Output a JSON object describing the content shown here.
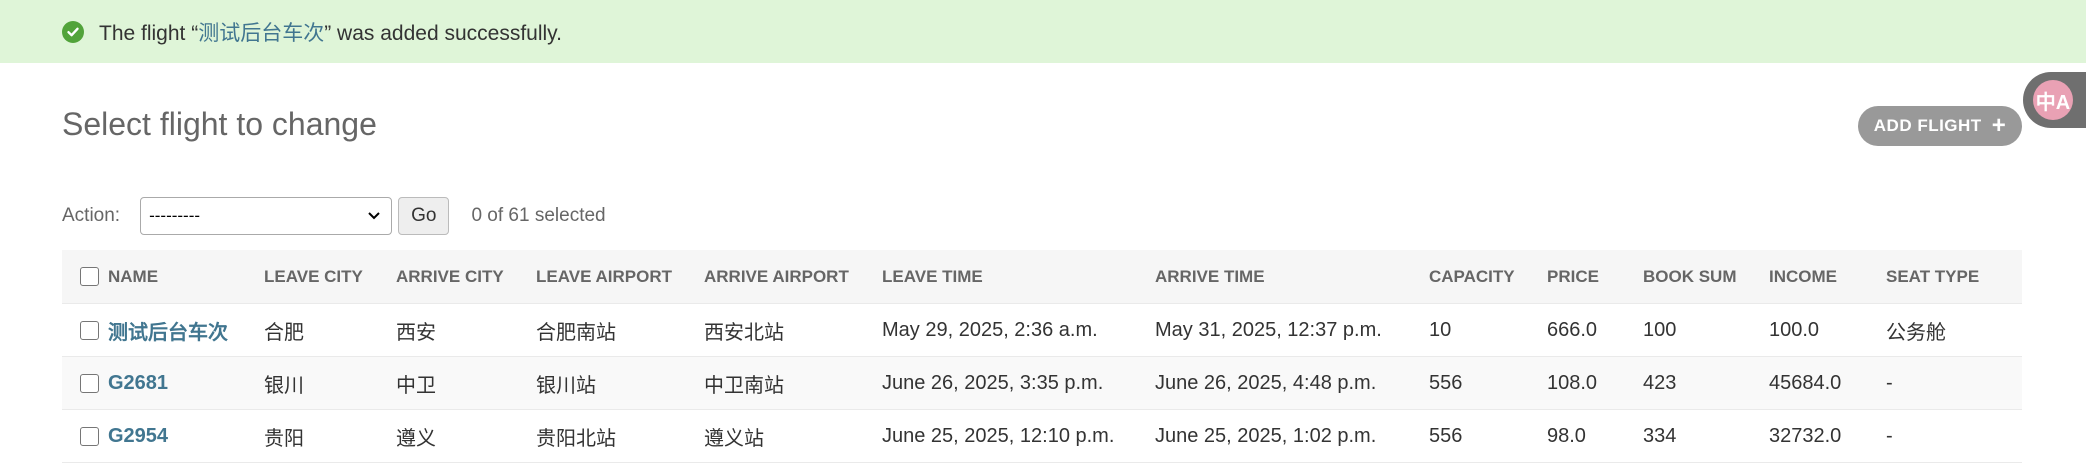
{
  "message": {
    "prefix": "The flight “",
    "link": "测试后台车次",
    "suffix": "” was added successfully."
  },
  "translate_button": {
    "glyph": "中A"
  },
  "page_title": "Select flight to change",
  "add_button": {
    "label": "Add flight",
    "icon": "+"
  },
  "actions": {
    "label": "Action:",
    "selected_value": "---------",
    "go_label": "Go",
    "count_text": "0 of 61 selected"
  },
  "table": {
    "columns": [
      "Name",
      "Leave city",
      "Arrive city",
      "Leave airport",
      "Arrive airport",
      "Leave time",
      "Arrive time",
      "Capacity",
      "Price",
      "Book sum",
      "Income",
      "Seat type"
    ],
    "rows": [
      [
        "测试后台车次",
        "合肥",
        "西安",
        "合肥南站",
        "西安北站",
        "May 29, 2025, 2:36 a.m.",
        "May 31, 2025, 12:37 p.m.",
        "10",
        "666.0",
        "100",
        "100.0",
        "公务舱"
      ],
      [
        "G2681",
        "银川",
        "中卫",
        "银川站",
        "中卫南站",
        "June 26, 2025, 3:35 p.m.",
        "June 26, 2025, 4:48 p.m.",
        "556",
        "108.0",
        "423",
        "45684.0",
        "-"
      ],
      [
        "G2954",
        "贵阳",
        "遵义",
        "贵阳北站",
        "遵义站",
        "June 25, 2025, 12:10 p.m.",
        "June 25, 2025, 1:02 p.m.",
        "556",
        "98.0",
        "334",
        "32732.0",
        "-"
      ]
    ]
  },
  "colors": {
    "success_bg": "#dff5d8",
    "success_icon": "#51a33a",
    "link": "#417690",
    "header_bg": "#f6f6f6"
  }
}
